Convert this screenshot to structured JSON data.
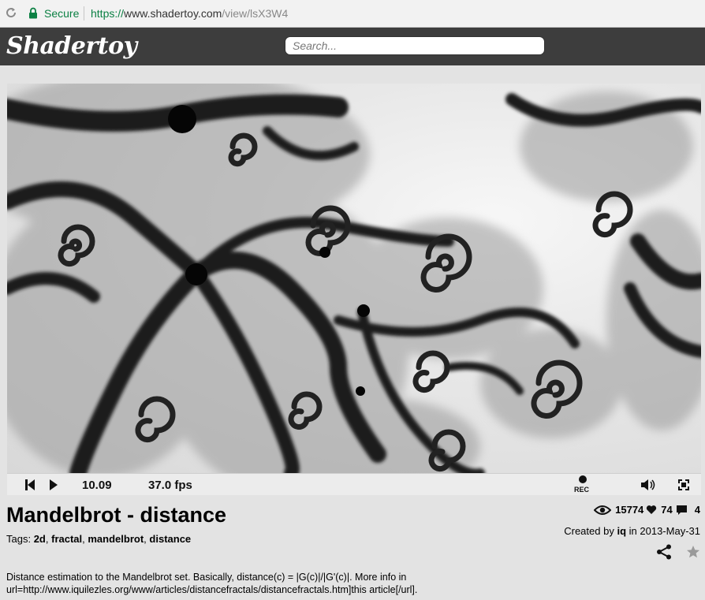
{
  "browser": {
    "secure_label": "Secure",
    "url_protocol": "https://",
    "url_host": "www.shadertoy.com",
    "url_path": "/view/lsX3W4"
  },
  "site": {
    "logo": "Shadertoy",
    "search_placeholder": "Search..."
  },
  "player": {
    "time": "10.09",
    "fps": "37.0 fps",
    "rec_label": "REC"
  },
  "shader": {
    "title": "Mandelbrot - distance",
    "tags_label": "Tags:",
    "tags": [
      "2d",
      "fractal",
      "mandelbrot",
      "distance"
    ],
    "views": "15774",
    "likes": "74",
    "comments": "4",
    "created_prefix": "Created by",
    "author": "iq",
    "created_in": "in",
    "date": "2013-May-31",
    "description": "Distance estimation to the Mandelbrot set. Basically, distance(c) = |G(c)|/|G'(c)|. More info in url=http://www.iquilezles.org/www/articles/distancefractals/distancefractals.htm]this article[/url]."
  },
  "colors": {
    "header_bg": "#3d3d3d",
    "secure_green": "#0b8043",
    "page_bg": "#e3e3e3"
  },
  "icons": [
    "reload-icon",
    "lock-icon",
    "rewind-icon",
    "play-icon",
    "rec-icon",
    "volume-icon",
    "fullscreen-icon",
    "eye-icon",
    "heart-icon",
    "comment-icon",
    "share-icon",
    "star-icon"
  ]
}
